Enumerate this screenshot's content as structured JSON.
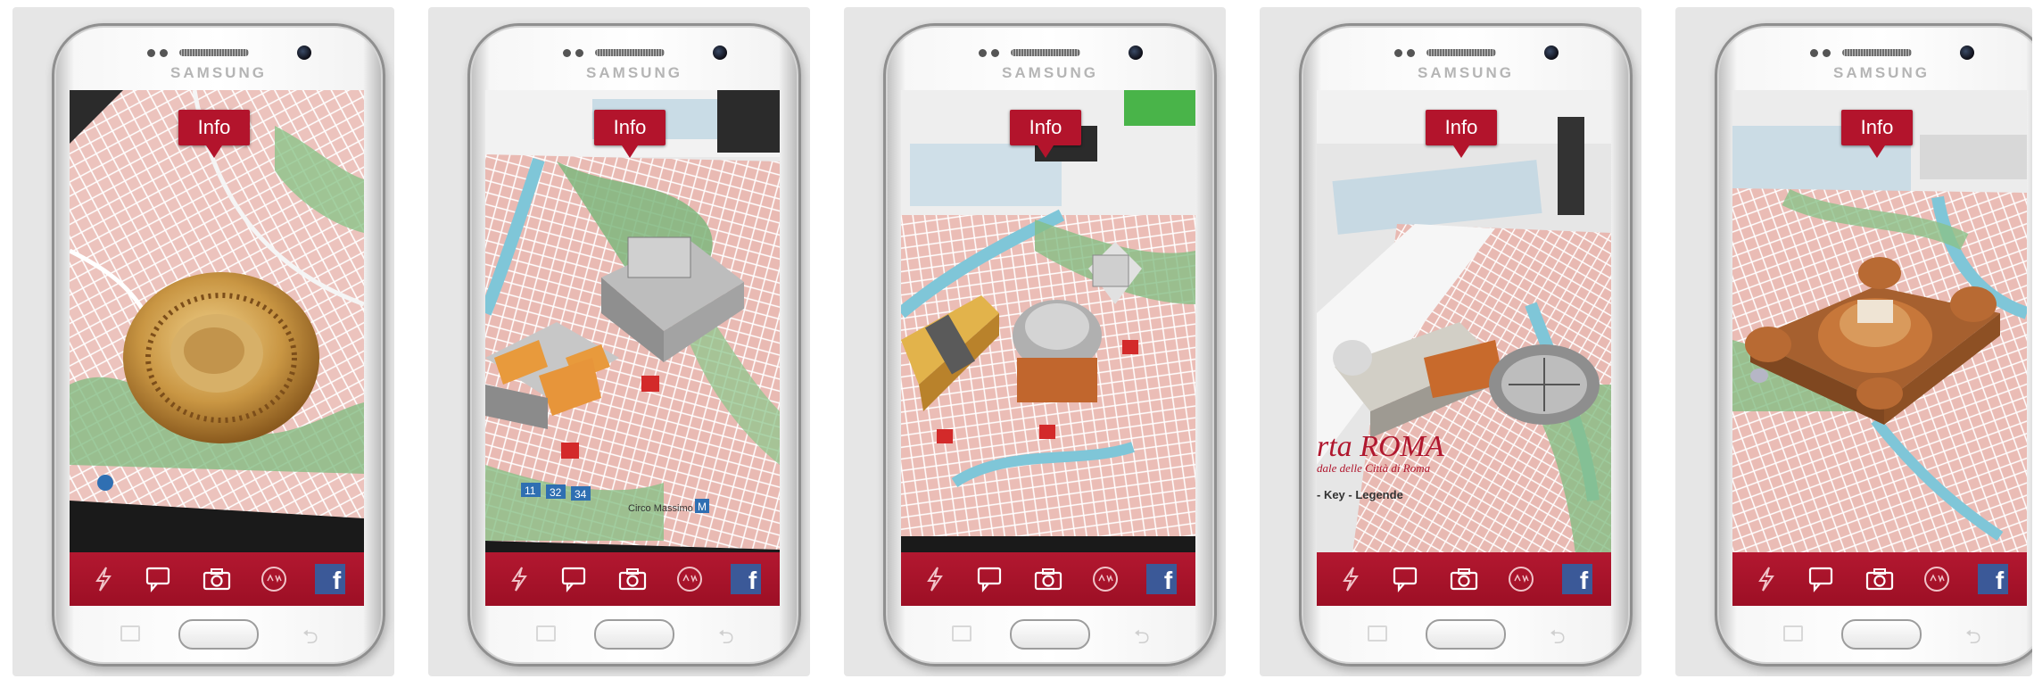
{
  "phones": [
    {
      "brand": "SAMSUNG",
      "info_label": "Info",
      "facebook_label": "f"
    },
    {
      "brand": "SAMSUNG",
      "info_label": "Info",
      "facebook_label": "f"
    },
    {
      "brand": "SAMSUNG",
      "info_label": "Info",
      "facebook_label": "f"
    },
    {
      "brand": "SAMSUNG",
      "info_label": "Info",
      "facebook_label": "f"
    },
    {
      "brand": "SAMSUNG",
      "info_label": "Info",
      "facebook_label": "f"
    }
  ],
  "map_labels": {
    "phone2": {
      "bus_lines": [
        "11",
        "32",
        "34"
      ],
      "place": "Circo Massimo",
      "metro": "M"
    },
    "phone4": {
      "title": "rta ROMA",
      "subtitle": "dale delle Città di Roma",
      "legend": "- Key - Legende"
    }
  },
  "toolbar_icons": [
    "flash-icon",
    "chat-icon",
    "camera-icon",
    "aw-icon",
    "facebook-icon"
  ],
  "colors": {
    "accent_red": "#b3142c",
    "facebook_blue": "#3b5998",
    "map_pink": "#e9b9b4",
    "map_green": "#7fb77e",
    "river_blue": "#7fc6d8"
  }
}
